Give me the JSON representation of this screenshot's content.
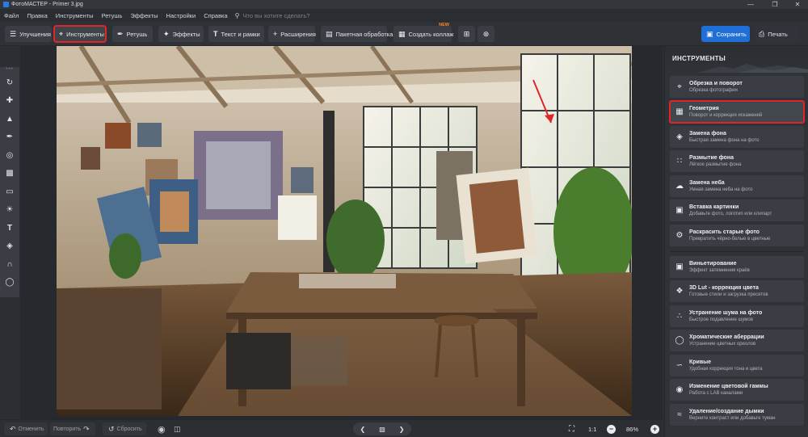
{
  "titlebar": {
    "title": "ФотоМАСТЕР - Primer 3.jpg",
    "minimize": "—",
    "maximize": "❐",
    "close": "✕"
  },
  "menu": {
    "items": [
      "Файл",
      "Правка",
      "Инструменты",
      "Ретушь",
      "Эффекты",
      "Настройки",
      "Справка"
    ],
    "search_placeholder": "Что вы хотите сделать?"
  },
  "toolbar": {
    "improve": "Улучшения",
    "tools": "Инструменты",
    "retouch": "Ретушь",
    "effects": "Эффекты",
    "text_frames": "Текст и рамки",
    "extensions": "Расширения",
    "batch": "Пакетная обработка",
    "collage": "Создать коллаж",
    "collage_badge": "NEW",
    "save": "Сохранить",
    "print": "Печать"
  },
  "panel": {
    "title": "ИНСТРУМЕНТЫ",
    "items": [
      {
        "title": "Обрезка и поворот",
        "sub": "Обрезка фотографии",
        "icon": "crop-icon"
      },
      {
        "title": "Геометрия",
        "sub": "Поворот и коррекция искажений",
        "icon": "geometry-icon"
      },
      {
        "title": "Замена фона",
        "sub": "Быстрая замена фона на фото",
        "icon": "background-replace-icon"
      },
      {
        "title": "Размытие фона",
        "sub": "Лёгкое размытие фона",
        "icon": "blur-icon"
      },
      {
        "title": "Замена неба",
        "sub": "Умная замена неба на фото",
        "icon": "sky-icon"
      },
      {
        "title": "Вставка картинки",
        "sub": "Добавьте фото, логотип или клипарт",
        "icon": "insert-image-icon"
      },
      {
        "title": "Раскрасить старые фото",
        "sub": "Превратить чёрно-белые в цветные",
        "icon": "colorize-icon"
      },
      {
        "title": "Виньетирование",
        "sub": "Эффект затемнения краёв",
        "icon": "vignette-icon"
      },
      {
        "title": "3D Lut - коррекция цвета",
        "sub": "Готовые стили и загрузка пресетов",
        "icon": "lut-icon"
      },
      {
        "title": "Устранение шума на фото",
        "sub": "Быстрое подавление шумов",
        "icon": "denoise-icon"
      },
      {
        "title": "Хроматические аберрации",
        "sub": "Устранение цветных ореолов",
        "icon": "chromatic-icon"
      },
      {
        "title": "Кривые",
        "sub": "Удобная коррекция тона и цвета",
        "icon": "curves-icon"
      },
      {
        "title": "Изменение цветовой гаммы",
        "sub": "Работа с LAB каналами",
        "icon": "color-gamut-icon"
      },
      {
        "title": "Удаление/создание дымки",
        "sub": "Верните контраст или добавьте туман",
        "icon": "dehaze-icon"
      }
    ]
  },
  "bottom": {
    "undo": "Отменить",
    "redo": "Повторить",
    "reset": "Сбросить",
    "ratio": "1:1",
    "zoom": "86%"
  },
  "colors": {
    "accent": "#1f6fd6",
    "highlight": "#e0262a",
    "badge": "#ff8a2a"
  }
}
